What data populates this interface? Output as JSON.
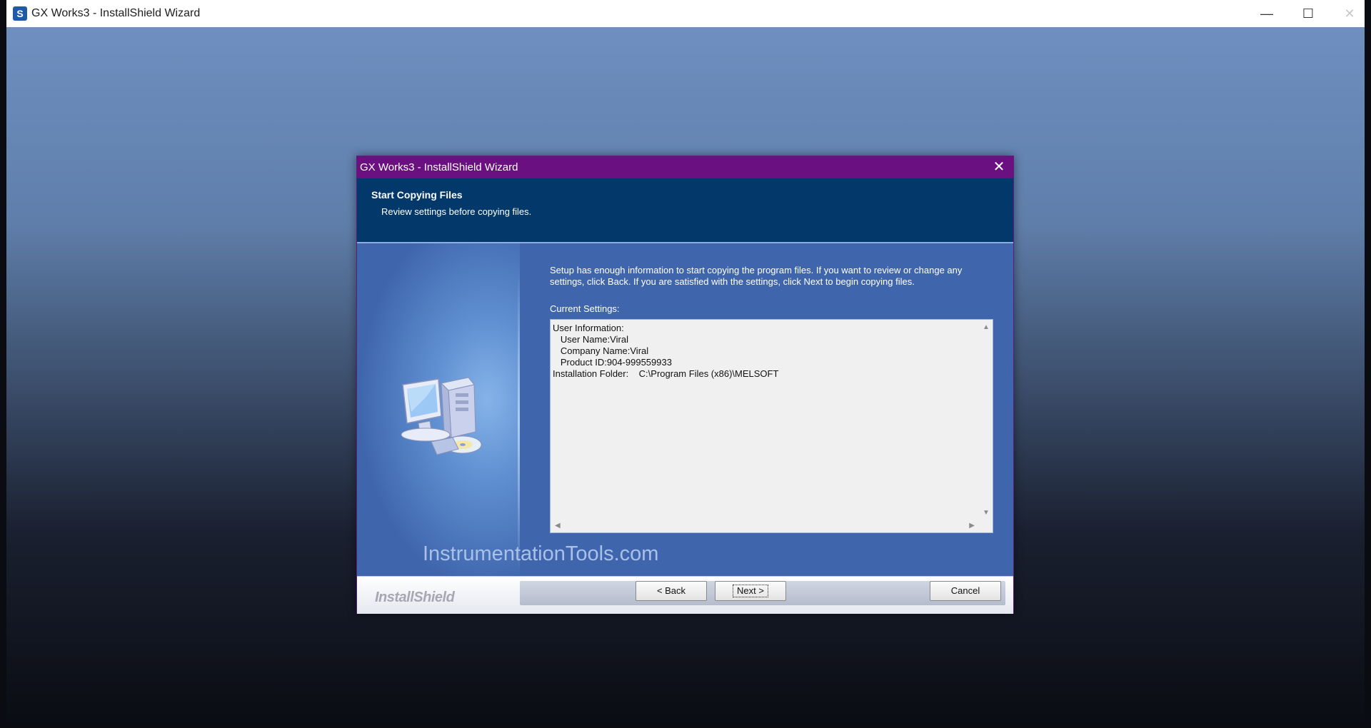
{
  "outer_window": {
    "title": "GX Works3 - InstallShield Wizard",
    "controls": {
      "minimize": "—",
      "maximize": "☐",
      "close": "✕"
    }
  },
  "dialog": {
    "title": "GX Works3 - InstallShield Wizard",
    "close": "✕",
    "header": {
      "title": "Start Copying Files",
      "subtitle": "Review settings before copying files."
    },
    "body": {
      "setup_text": "Setup has enough information to start copying the program files.  If you want to review or change any settings, click Back.  If you are satisfied with the settings, click Next to begin copying files.",
      "settings_label": "Current Settings:",
      "settings_text": "User Information:\n   User Name:Viral\n   Company Name:Viral\n   Product ID:904-999559933\nInstallation Folder:    C:\\Program Files (x86)\\MELSOFT",
      "watermark": "InstrumentationTools.com"
    },
    "footer": {
      "brand": "InstallShield",
      "back_label": "< Back",
      "next_label": "Next >",
      "cancel_label": "Cancel"
    }
  },
  "colors": {
    "dialog_titlebar": "#6b1080",
    "header_band": "#03386b",
    "body": "#3f66ad"
  }
}
